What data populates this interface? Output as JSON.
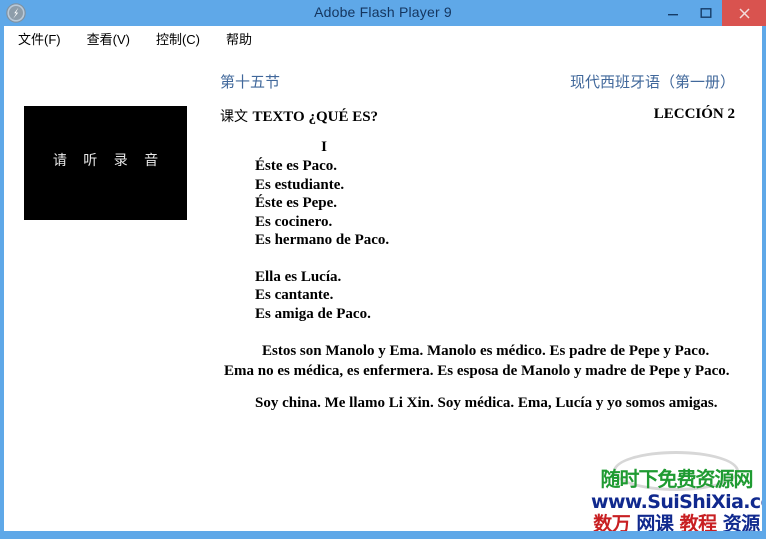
{
  "window": {
    "title": "Adobe Flash Player 9",
    "icon": "flash-player-icon",
    "controls": {
      "minimize": "minimize-icon",
      "maximize": "maximize-icon",
      "close": "close-icon"
    },
    "title_bar_color": "#5fa8e8",
    "close_button_color": "#d9534f"
  },
  "menu": {
    "items": [
      {
        "label": "文件(F)"
      },
      {
        "label": "查看(V)"
      },
      {
        "label": "控制(C)"
      },
      {
        "label": "帮助"
      }
    ]
  },
  "stage": {
    "video": {
      "caption": "请 听 录 音",
      "background": "#000000"
    },
    "header": {
      "lesson_no": "第十五节",
      "book_title": "现代西班牙语（第一册）",
      "texto_label_cn": "课文",
      "texto_label_es": "TEXTO   ¿QUÉ ES?",
      "leccion": "LECCIÓN 2",
      "accent_color": "#41689b"
    },
    "text": {
      "roman_numeral": "I",
      "block1": [
        "Éste es Paco.",
        "Es estudiante.",
        "Éste es Pepe.",
        "Es cocinero.",
        "Es hermano de Paco."
      ],
      "block2": [
        "Ella es Lucía.",
        "Es  cantante.",
        "Es amiga de Paco."
      ],
      "paragraph1": "Estos son Manolo y Ema. Manolo es médico. Es padre de Pepe y Paco. Ema no es médica, es enfermera. Es esposa de Manolo y madre de Pepe y Paco.",
      "paragraph2": "Soy china. Me llamo Li Xin. Soy médica. Ema, Lucía y yo somos amigas."
    }
  },
  "watermark": {
    "line1": "随时下免费资源网",
    "line2": "www.SuiShiXia.com",
    "line3_parts": [
      {
        "text": "数万",
        "color": "#c81f22"
      },
      {
        "text": "网课",
        "color": "#10298e"
      },
      {
        "text": "教程",
        "color": "#c81f22"
      },
      {
        "text": "资源",
        "color": "#10298e"
      }
    ],
    "green": "#1f9b32",
    "navy": "#10298e",
    "red": "#c81f22"
  }
}
